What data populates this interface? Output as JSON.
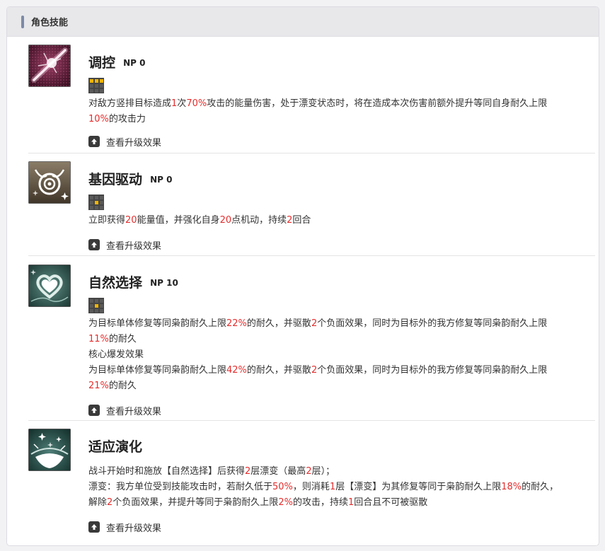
{
  "panel": {
    "title": "角色技能"
  },
  "upgrade_label": "查看升级效果",
  "colors": {
    "highlight": "#e52d2d",
    "grid_on": "#f0b400",
    "header_bar": "#7d8aa6"
  },
  "skills": [
    {
      "name": "调控",
      "np": "NP 0",
      "icon": "light-beam-icon",
      "cost_cells": 3,
      "desc": [
        [
          [
            "对敌方竖排目标造成",
            false
          ],
          [
            "1",
            true
          ],
          [
            "次",
            false
          ],
          [
            "70%",
            true
          ],
          [
            "攻击的能量伤害，处于漂变状态时，将在造成本次伤害前额外提升等同自身耐久上限",
            false
          ]
        ],
        [
          [
            "10%",
            true
          ],
          [
            "的攻击力",
            false
          ]
        ]
      ]
    },
    {
      "name": "基因驱动",
      "np": "NP 0",
      "icon": "target-emblem-icon",
      "cost_cells": 1,
      "desc": [
        [
          [
            "立即获得",
            false
          ],
          [
            "20",
            true
          ],
          [
            "能量值，并强化自身",
            false
          ],
          [
            "20",
            true
          ],
          [
            "点机动，持续",
            false
          ],
          [
            "2",
            true
          ],
          [
            "回合",
            false
          ]
        ]
      ]
    },
    {
      "name": "自然选择",
      "np": "NP 10",
      "icon": "heart-icon",
      "cost_cells": 1,
      "desc": [
        [
          [
            "为目标单体修复等同枭韵耐久上限",
            false
          ],
          [
            "22%",
            true
          ],
          [
            "的耐久，并驱散",
            false
          ],
          [
            "2",
            true
          ],
          [
            "个负面效果，同时为目标外的我方修复等同枭韵耐久上限",
            false
          ]
        ],
        [
          [
            "11%",
            true
          ],
          [
            "的耐久",
            false
          ]
        ],
        [
          [
            "核心爆发效果",
            false
          ]
        ],
        [
          [
            "为目标单体修复等同枭韵耐久上限",
            false
          ],
          [
            "42%",
            true
          ],
          [
            "的耐久，并驱散",
            false
          ],
          [
            "2",
            true
          ],
          [
            "个负面效果，同时为目标外的我方修复等同枭韵耐久上限",
            false
          ]
        ],
        [
          [
            "21%",
            true
          ],
          [
            "的耐久",
            false
          ]
        ]
      ]
    },
    {
      "name": "适应演化",
      "np": "",
      "icon": "sparkle-heart-icon",
      "cost_cells": 0,
      "desc": [
        [
          [
            "战斗开始时和施放【自然选择】后获得",
            false
          ],
          [
            "2",
            true
          ],
          [
            "层漂变（最高",
            false
          ],
          [
            "2",
            true
          ],
          [
            "层）；",
            false
          ]
        ],
        [
          [
            "漂变：我方单位受到技能攻击时，若耐久低于",
            false
          ],
          [
            "50%",
            true
          ],
          [
            "，则消耗",
            false
          ],
          [
            "1",
            true
          ],
          [
            "层【漂变】为其修复等同于枭韵耐久上限",
            false
          ],
          [
            "18%",
            true
          ],
          [
            "的耐久，",
            false
          ]
        ],
        [
          [
            "解除",
            false
          ],
          [
            "2",
            true
          ],
          [
            "个负面效果，并提升等同于枭韵耐久上限",
            false
          ],
          [
            "2%",
            true
          ],
          [
            "的攻击，持续",
            false
          ],
          [
            "1",
            true
          ],
          [
            "回合且不可被驱散",
            false
          ]
        ]
      ]
    }
  ]
}
